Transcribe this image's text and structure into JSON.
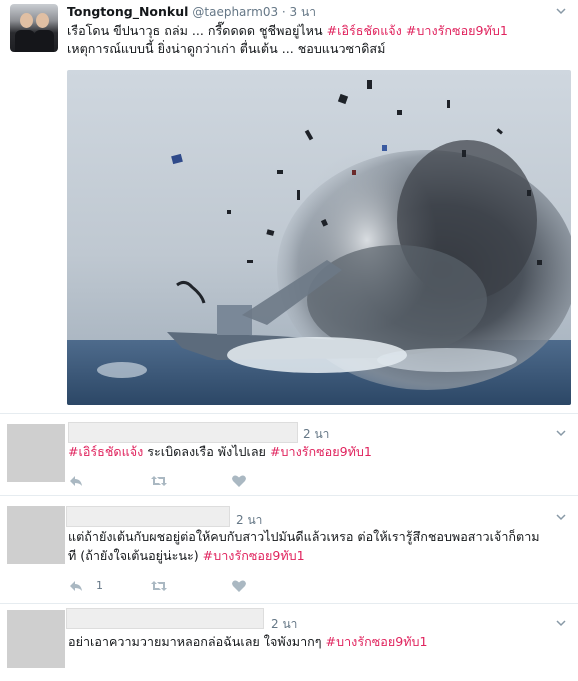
{
  "tweet": {
    "display_name": "Tongtong_Nonkul",
    "handle": "@taepharm03",
    "separator": " · ",
    "time": "3 นา",
    "line1_text": "เรือโดน ขีปนาวุธ ถล่ม ... กรี๊ดดดด ชูชีพอยู่ไหน ",
    "line1_tag1": "#เอิร์ธชัดแจ้ง",
    "line1_tag2": "#บางรักซอย9ทับ1",
    "line2_text": "เหตุการณ์แบบนี้ ยิ่งน่าดูกว่าเก่า ตื่นเต้น ... ชอบแนวซาดิสม์"
  },
  "replies": [
    {
      "time": "2 นา",
      "line1_tag": "#เอิร์ธชัดแจ้ง",
      "line1_text": " ระเบิดลงเรือ พังไปเลย ",
      "line1_tag2": "#บางรักซอย9ทับ1",
      "like_count": ""
    },
    {
      "time": "2 นา",
      "line1_text": "แต่ถ้ายังเต้นกับผชอยู่ต่อให้คบกับสาวไปมันดีแล้วเหรอ ต่อให้เรารู้สึกชอบพอสาวเจ้าก็ตาม",
      "line2_text": "ที (ถ้ายังใจเต้นอยู่น่ะนะ) ",
      "line2_tag": "#บางรักซอย9ทับ1",
      "reply_count": "1"
    },
    {
      "time": "2 นา",
      "line1_text": "อย่าเอาความวายมาหลอกล่อฉันเลย ใจพังมากๆ ",
      "line1_tag": "#บางรักซอย9ทับ1"
    }
  ],
  "icons": [
    "reply-icon",
    "retweet-icon",
    "like-icon",
    "chevron-down-icon"
  ],
  "colors": {
    "hashtag": "#e0245e",
    "meta": "#657786",
    "icon": "#aab8c2",
    "divider": "#e6ecf0"
  }
}
